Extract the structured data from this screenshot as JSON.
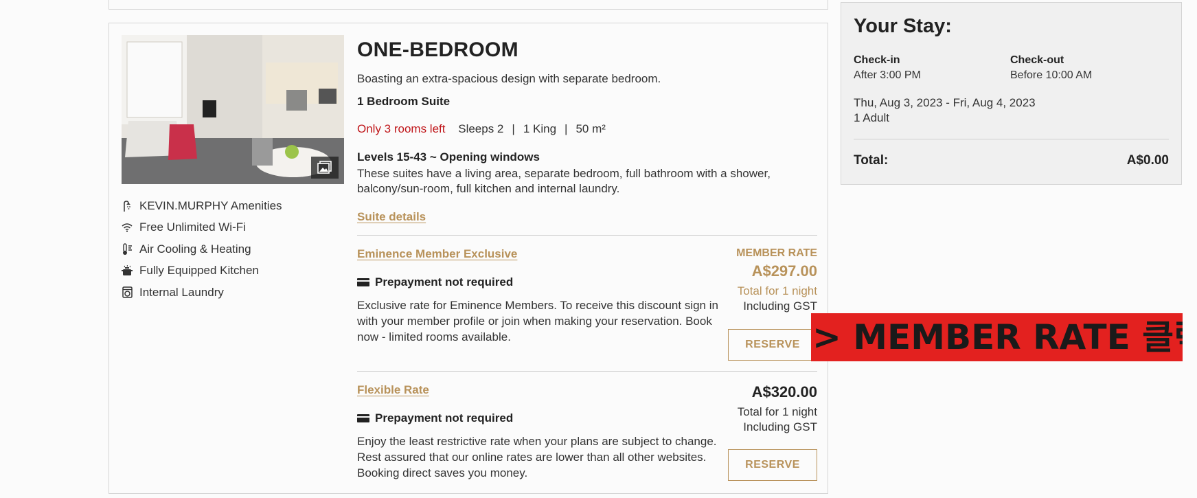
{
  "room": {
    "title": "ONE-BEDROOM",
    "description": "Boasting an extra-spacious design with separate bedroom.",
    "type": "1 Bedroom Suite",
    "availability": "Only 3 rooms left",
    "sleeps": "Sleeps 2",
    "bed": "1 King",
    "size": "50 m²",
    "levels_title": "Levels 15-43 ~ Opening windows",
    "levels_desc": "These suites have a living area, separate bedroom, full bathroom with a shower, balcony/sun-room, full kitchen and internal laundry.",
    "suite_details_link": "Suite details",
    "amenities": [
      {
        "icon": "shower-icon",
        "label": "KEVIN.MURPHY Amenities"
      },
      {
        "icon": "wifi-icon",
        "label": "Free Unlimited Wi-Fi"
      },
      {
        "icon": "thermometer-fan-icon",
        "label": "Air Cooling & Heating"
      },
      {
        "icon": "pot-icon",
        "label": "Fully Equipped Kitchen"
      },
      {
        "icon": "washing-machine-icon",
        "label": "Internal Laundry"
      }
    ]
  },
  "rates": [
    {
      "name": "Eminence Member Exclusive",
      "tag": "MEMBER RATE",
      "price": "A$297.00",
      "total": "Total for 1 night",
      "gst": "Including GST",
      "prepay": "Prepayment not required",
      "description": "Exclusive rate for Eminence Members. To receive this discount sign in with your member profile or join when making your reservation. Book now - limited rooms available.",
      "reserve": "RESERVE"
    },
    {
      "name": "Flexible Rate",
      "price": "A$320.00",
      "total": "Total for 1 night",
      "gst": "Including GST",
      "prepay": "Prepayment not required",
      "description": "Enjoy the least restrictive rate when your plans are subject to change. Rest assured that our online rates are lower than all other websites. Booking direct saves you money.",
      "reserve": "RESERVE"
    }
  ],
  "stay": {
    "title": "Your Stay:",
    "checkin_label": "Check-in",
    "checkin_value": "After 3:00 PM",
    "checkout_label": "Check-out",
    "checkout_value": "Before 10:00 AM",
    "dates": "Thu, Aug 3, 2023 - Fri, Aug 4, 2023",
    "guests": "1 Adult",
    "total_label": "Total:",
    "total_value": "A$0.00"
  },
  "annotation": {
    "text": "> MEMBER RATE 클릭!",
    "color": "#e3211f"
  },
  "colors": {
    "accent_gold": "#b8925a",
    "alert_red": "#c0171b"
  }
}
